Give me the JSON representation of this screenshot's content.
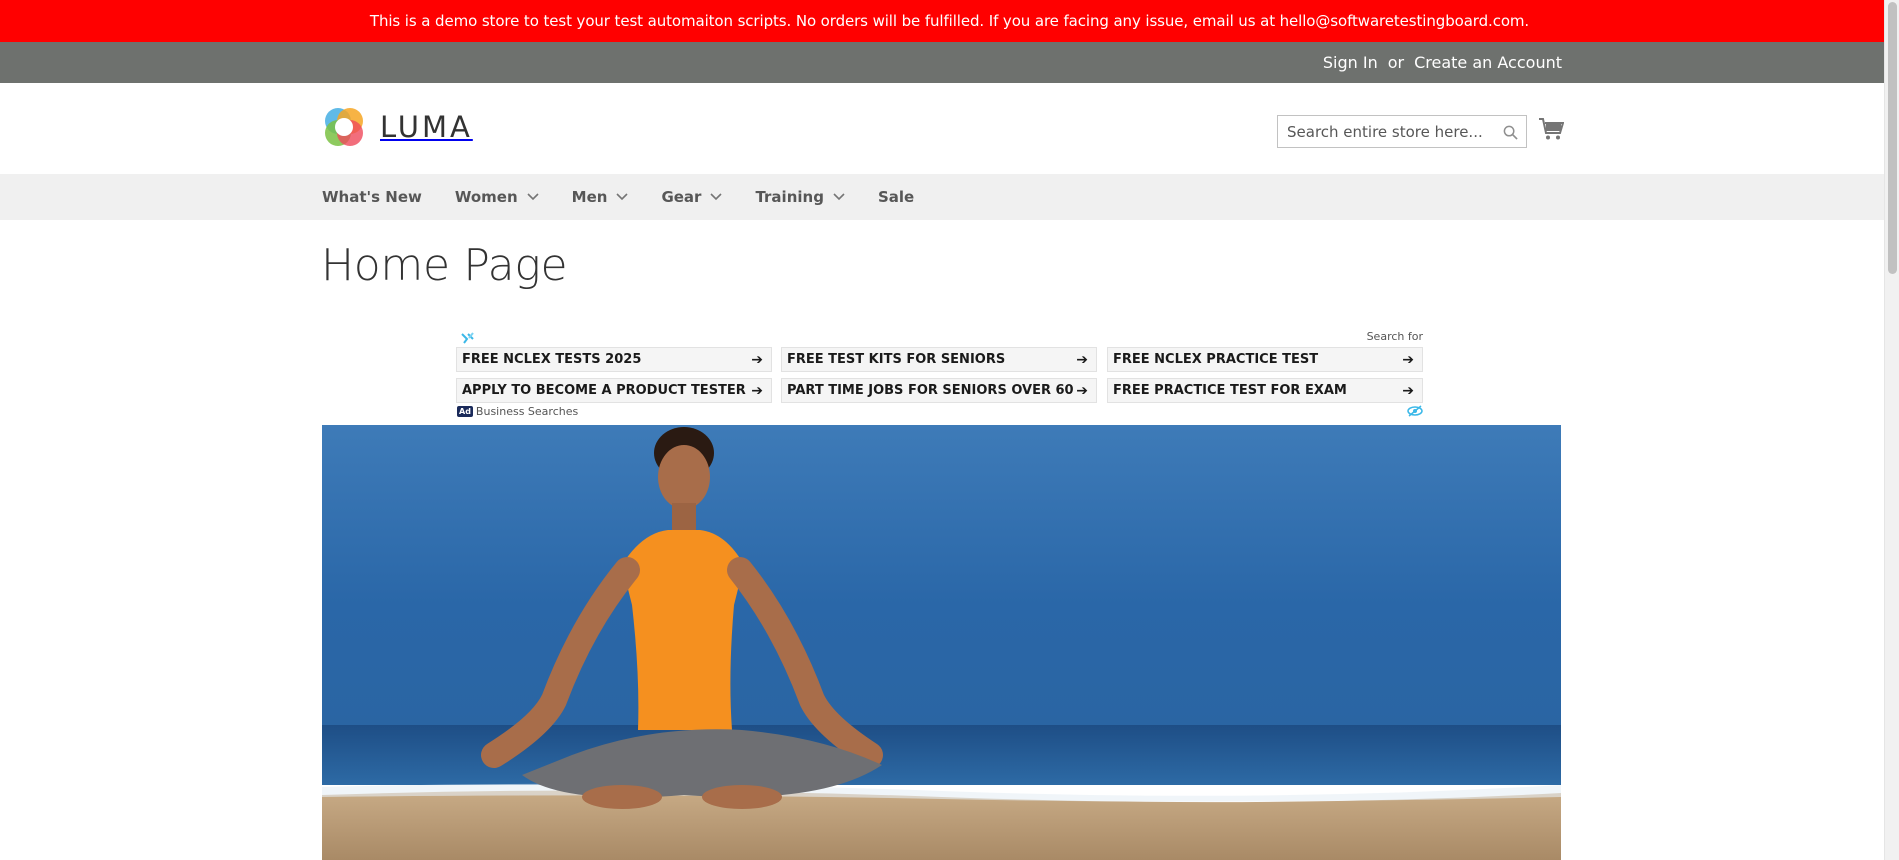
{
  "demo_banner": {
    "text": "This is a demo store to test your test automaiton scripts. No orders will be fulfilled. If you are facing any issue, email us at hello@softwaretestingboard.com."
  },
  "panel": {
    "sign_in": "Sign In",
    "or": "or",
    "create_account": "Create an Account"
  },
  "logo": {
    "text": "LUMA"
  },
  "search": {
    "placeholder": "Search entire store here..."
  },
  "nav": {
    "items": [
      {
        "label": "What's New",
        "has_dropdown": false
      },
      {
        "label": "Women",
        "has_dropdown": true
      },
      {
        "label": "Men",
        "has_dropdown": true
      },
      {
        "label": "Gear",
        "has_dropdown": true
      },
      {
        "label": "Training",
        "has_dropdown": true
      },
      {
        "label": "Sale",
        "has_dropdown": false
      }
    ]
  },
  "page_title": "Home Page",
  "ad": {
    "search_for": "Search for",
    "items": [
      "FREE NCLEX TESTS 2025",
      "FREE TEST KITS FOR SENIORS",
      "FREE NCLEX PRACTICE TEST",
      "APPLY TO BECOME A PRODUCT TESTER",
      "PART TIME JOBS FOR SENIORS OVER 60",
      "FREE PRACTICE TEST FOR EXAM"
    ],
    "arrow": "➔",
    "badge": "Ad",
    "footer": "Business Searches"
  },
  "colors": {
    "banner": "#ff0000",
    "panel": "#6e716e",
    "nav_bg": "#f0f0f0"
  },
  "icons": [
    "search-icon",
    "cart-icon",
    "chevron-down-icon",
    "arrow-right-icon",
    "eye-icon"
  ]
}
